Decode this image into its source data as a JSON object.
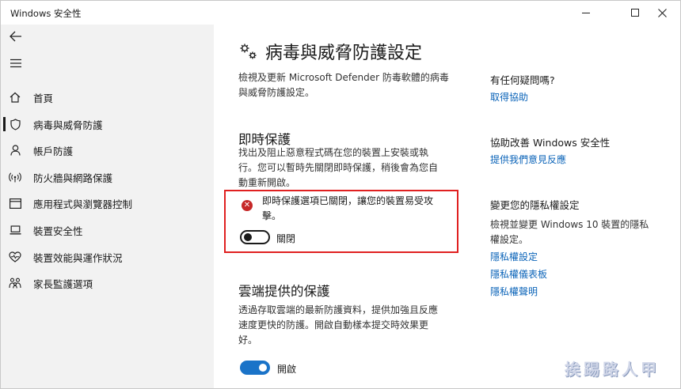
{
  "window": {
    "title": "Windows 安全性"
  },
  "sidebar": {
    "items": [
      {
        "label": "首頁",
        "icon": "home-icon"
      },
      {
        "label": "病毒與威脅防護",
        "icon": "shield-icon",
        "active": true
      },
      {
        "label": "帳戶防護",
        "icon": "person-icon"
      },
      {
        "label": "防火牆與網路保護",
        "icon": "wireless-icon"
      },
      {
        "label": "應用程式與瀏覽器控制",
        "icon": "app-window-icon"
      },
      {
        "label": "裝置安全性",
        "icon": "laptop-icon"
      },
      {
        "label": "裝置效能與運作狀況",
        "icon": "heart-icon"
      },
      {
        "label": "家長監護選項",
        "icon": "family-icon"
      }
    ]
  },
  "main": {
    "title": "病毒與威脅防護設定",
    "intro_line1": "檢視及更新 Microsoft Defender 防毒軟體的病毒",
    "intro_line2": "與威脅防護設定。",
    "realtime": {
      "title": "即時保護",
      "desc_line1": "找出及阻止惡意程式碼在您的裝置上安裝或執",
      "desc_line2": "行。您可以暫時先關閉即時保護，稍後會為您自",
      "desc_line3": "動重新開啟。",
      "warning_line1": "即時保護選項已關閉，讓您的裝置易受攻",
      "warning_line2": "擊。",
      "toggle_label": "關閉",
      "toggle_on": false
    },
    "cloud": {
      "title": "雲端提供的保護",
      "desc_line1": "透過存取雲端的最新防護資料，提供加強且反應",
      "desc_line2": "速度更快的防護。開啟自動樣本提交時效果更",
      "desc_line3": "好。",
      "toggle_label": "開啟",
      "toggle_on": true
    }
  },
  "right": {
    "help_title": "有任何疑問嗎?",
    "help_link": "取得協助",
    "improve_title": "協助改善 Windows 安全性",
    "improve_link": "提供我們意見反應",
    "privacy_title": "變更您的隱私權設定",
    "privacy_desc_line1": "檢視並變更 Windows 10 裝置的隱私",
    "privacy_desc_line2": "權設定。",
    "privacy_links": [
      "隱私權設定",
      "隱私權儀表板",
      "隱私權聲明"
    ]
  },
  "watermark": "挨踢路人甲",
  "colors": {
    "accent": "#1a73c8",
    "link": "#0a63b8",
    "error": "#c62828",
    "highlight_border": "#e02020"
  }
}
